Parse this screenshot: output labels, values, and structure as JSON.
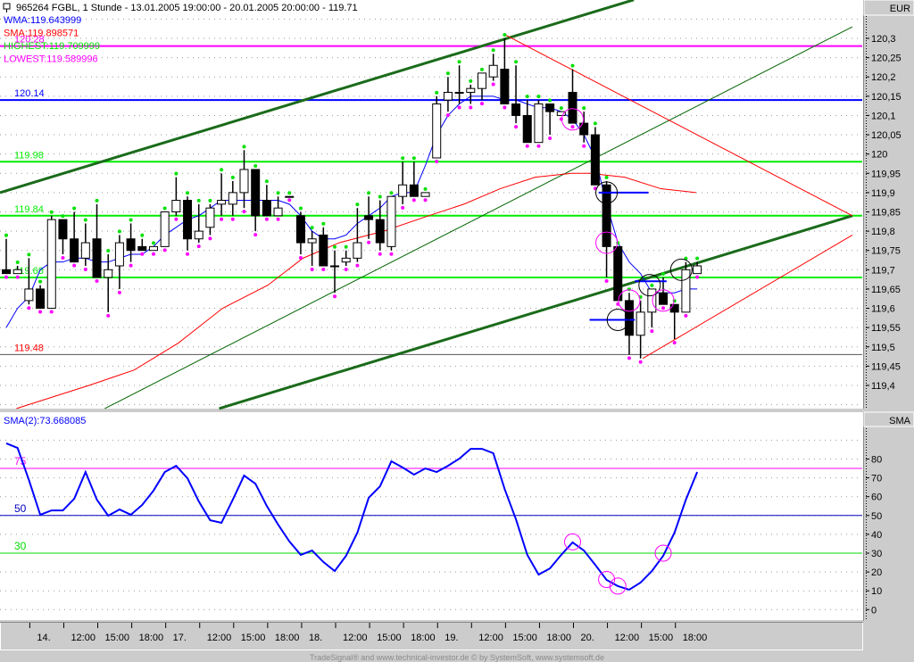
{
  "header": {
    "title": "965264  FGBL, 1 Stunde - 13.01.2005 19:00:00 - 20.01.2005 20:00:00 - 119.71",
    "currency": "EUR",
    "lower_axis_title": "SMA",
    "footer": "TradeSignal® and www.technical-investor.de © by SystemSoft, www.systemsoft.de"
  },
  "legend": [
    {
      "text": "WMA:119.643999",
      "color": "#0000ff"
    },
    {
      "text": "SMA:119.898571",
      "color": "#ff0000"
    },
    {
      "text": "HIGHEST:119.709999",
      "color": "#00e000"
    },
    {
      "text": "LOWEST:119.589996",
      "color": "#ff00ff"
    }
  ],
  "colors": {
    "wma": "#0000ff",
    "sma": "#ff0000",
    "channel": "#006400",
    "green_dot": "#00e000",
    "pink_dot": "#ff00ff",
    "oscillator": "#0000ff"
  },
  "chart_data": [
    {
      "type": "candlestick",
      "title": "965264 FGBL, 1 Stunde",
      "ylabel": "EUR",
      "ylim": [
        119.35,
        120.36
      ],
      "yticks": [
        "120,3",
        "120,25",
        "120,2",
        "120,15",
        "120,1",
        "120,05",
        "120",
        "119,95",
        "119,9",
        "119,85",
        "119,8",
        "119,75",
        "119,7",
        "119,65",
        "119,6",
        "119,55",
        "119,5",
        "119,45",
        "119,4"
      ],
      "ytick_values": [
        120.3,
        120.25,
        120.2,
        120.15,
        120.1,
        120.05,
        120.0,
        119.95,
        119.9,
        119.85,
        119.8,
        119.75,
        119.7,
        119.65,
        119.6,
        119.55,
        119.5,
        119.45,
        119.4
      ],
      "xticks": [
        "14.",
        "12:00",
        "15:00",
        "18:00",
        "17.",
        "12:00",
        "15:00",
        "18:00",
        "18.",
        "12:00",
        "15:00",
        "18:00",
        "19.",
        "12:00",
        "15:00",
        "18:00",
        "20.",
        "12:00",
        "15:00",
        "18:00"
      ],
      "xtick_bar_index": [
        2,
        5,
        8,
        11,
        14,
        17,
        20,
        23,
        26,
        29,
        32,
        35,
        38,
        41,
        44,
        47,
        50,
        53,
        56,
        59
      ],
      "grid": true,
      "ohlc": [
        [
          119.7,
          119.78,
          119.69,
          119.69
        ],
        [
          119.69,
          119.71,
          119.69,
          119.7
        ],
        [
          119.62,
          119.73,
          119.61,
          119.65
        ],
        [
          119.65,
          119.66,
          119.6,
          119.6
        ],
        [
          119.6,
          119.84,
          119.6,
          119.83
        ],
        [
          119.83,
          119.83,
          119.74,
          119.78
        ],
        [
          119.78,
          119.85,
          119.72,
          119.72
        ],
        [
          119.73,
          119.82,
          119.71,
          119.77
        ],
        [
          119.78,
          119.87,
          119.68,
          119.68
        ],
        [
          119.68,
          119.74,
          119.59,
          119.7
        ],
        [
          119.71,
          119.79,
          119.65,
          119.77
        ],
        [
          119.78,
          119.82,
          119.72,
          119.75
        ],
        [
          119.76,
          119.78,
          119.75,
          119.75
        ],
        [
          119.75,
          119.76,
          119.75,
          119.76
        ],
        [
          119.76,
          119.85,
          119.76,
          119.85
        ],
        [
          119.85,
          119.94,
          119.84,
          119.88
        ],
        [
          119.88,
          119.89,
          119.75,
          119.78
        ],
        [
          119.78,
          119.87,
          119.77,
          119.8
        ],
        [
          119.81,
          119.87,
          119.79,
          119.86
        ],
        [
          119.87,
          119.95,
          119.84,
          119.88
        ],
        [
          119.87,
          119.93,
          119.84,
          119.9
        ],
        [
          119.9,
          120.01,
          119.86,
          119.96
        ],
        [
          119.96,
          119.96,
          119.8,
          119.84
        ],
        [
          119.88,
          119.92,
          119.84,
          119.84
        ],
        [
          119.84,
          119.89,
          119.84,
          119.86
        ],
        [
          119.89,
          119.89,
          119.89,
          119.89
        ],
        [
          119.84,
          119.85,
          119.74,
          119.77
        ],
        [
          119.77,
          119.8,
          119.71,
          119.78
        ],
        [
          119.79,
          119.81,
          119.71,
          119.71
        ],
        [
          119.71,
          119.75,
          119.64,
          119.71
        ],
        [
          119.72,
          119.75,
          119.71,
          119.73
        ],
        [
          119.73,
          119.86,
          119.72,
          119.77
        ],
        [
          119.84,
          119.89,
          119.78,
          119.83
        ],
        [
          119.83,
          119.88,
          119.75,
          119.77
        ],
        [
          119.76,
          119.89,
          119.75,
          119.89
        ],
        [
          119.89,
          119.98,
          119.87,
          119.92
        ],
        [
          119.92,
          119.98,
          119.89,
          119.89
        ],
        [
          119.89,
          119.9,
          119.89,
          119.9
        ],
        [
          119.99,
          120.15,
          119.99,
          120.13
        ],
        [
          120.14,
          120.2,
          120.11,
          120.16
        ],
        [
          120.16,
          120.23,
          120.13,
          120.16
        ],
        [
          120.16,
          120.18,
          120.13,
          120.17
        ],
        [
          120.17,
          120.21,
          120.14,
          120.21
        ],
        [
          120.2,
          120.26,
          120.19,
          120.23
        ],
        [
          120.22,
          120.3,
          120.13,
          120.13
        ],
        [
          120.13,
          120.23,
          120.08,
          120.1
        ],
        [
          120.1,
          120.14,
          120.03,
          120.03
        ],
        [
          120.03,
          120.14,
          120.03,
          120.13
        ],
        [
          120.13,
          120.13,
          120.05,
          120.11
        ],
        [
          120.1,
          120.11,
          120.1,
          120.11
        ],
        [
          120.16,
          120.22,
          120.08,
          120.08
        ],
        [
          120.08,
          120.11,
          120.03,
          120.05
        ],
        [
          120.05,
          120.07,
          119.92,
          119.92
        ],
        [
          119.92,
          119.93,
          119.68,
          119.76
        ],
        [
          119.76,
          119.76,
          119.62,
          119.62
        ],
        [
          119.62,
          119.64,
          119.48,
          119.53
        ],
        [
          119.53,
          119.62,
          119.47,
          119.59
        ],
        [
          119.59,
          119.65,
          119.55,
          119.65
        ],
        [
          119.64,
          119.68,
          119.61,
          119.61
        ],
        [
          119.61,
          119.61,
          119.52,
          119.59
        ],
        [
          119.59,
          119.72,
          119.59,
          119.7
        ],
        [
          119.69,
          119.72,
          119.69,
          119.71
        ]
      ],
      "wma": [
        119.55,
        119.6,
        119.63,
        119.7,
        119.72,
        119.72,
        119.73,
        119.73,
        119.72,
        119.72,
        119.73,
        119.74,
        119.74,
        119.76,
        119.79,
        119.81,
        119.83,
        119.84,
        119.86,
        119.88,
        119.88,
        119.88,
        119.88,
        119.88,
        119.88,
        119.87,
        119.84,
        119.8,
        119.78,
        119.78,
        119.79,
        119.82,
        119.84,
        119.86,
        119.89,
        119.9,
        119.9,
        119.97,
        120.05,
        120.1,
        120.13,
        120.15,
        120.15,
        120.15,
        120.14,
        120.14,
        120.13,
        120.12,
        120.12,
        120.11,
        120.09,
        120.05,
        119.99,
        119.87,
        119.77,
        119.72,
        119.69,
        119.64,
        119.64,
        119.64,
        119.65,
        119.65
      ],
      "sma_points": [
        [
          0.9,
          119.34
        ],
        [
          7.3,
          119.4
        ],
        [
          11.3,
          119.44
        ],
        [
          15.2,
          119.51
        ],
        [
          19.1,
          119.6
        ],
        [
          23.1,
          119.66
        ],
        [
          26.2,
          119.73
        ],
        [
          29.4,
          119.77
        ],
        [
          33.3,
          119.8
        ],
        [
          37.3,
          119.84
        ],
        [
          40.4,
          119.87
        ],
        [
          43.6,
          119.91
        ],
        [
          46.7,
          119.94
        ],
        [
          49.9,
          119.95
        ],
        [
          51.5,
          119.95
        ],
        [
          54.6,
          119.94
        ],
        [
          57.8,
          119.91
        ],
        [
          60.9,
          119.9
        ]
      ],
      "horizontal_levels": [
        {
          "label": "120.28",
          "value": 120.28,
          "color": "#ff00ff"
        },
        {
          "label": "120.14",
          "value": 120.14,
          "color": "#0000ff"
        },
        {
          "label": "119.98",
          "value": 119.98,
          "color": "#00ee00"
        },
        {
          "label": "119.84",
          "value": 119.84,
          "color": "#00ee00"
        },
        {
          "label": "119.68",
          "value": 119.68,
          "color": "#00ee00"
        },
        {
          "label": "119.48",
          "value": 119.48,
          "color": "#ff0000",
          "line_color": "#555555"
        }
      ],
      "trend_lines": [
        {
          "from": [
            -0.55,
            119.9
          ],
          "to": [
            55.4,
            120.4
          ],
          "color": "#1a6b1a",
          "weight": "thick"
        },
        {
          "from": [
            18.8,
            119.34
          ],
          "to": [
            74.7,
            119.84
          ],
          "color": "#1a6b1a",
          "weight": "thick"
        },
        {
          "from": [
            8.7,
            119.34
          ],
          "to": [
            74.7,
            120.33
          ],
          "color": "#006400",
          "weight": "thin"
        },
        {
          "from": [
            44.0,
            120.31
          ],
          "to": [
            74.7,
            119.84
          ],
          "color": "#ff0000",
          "weight": "thin"
        },
        {
          "from": [
            56.2,
            119.47
          ],
          "to": [
            74.7,
            119.79
          ],
          "color": "#ff0000",
          "weight": "thin"
        }
      ],
      "blue_segments": [
        [
          52.3,
          56.7,
          119.9
        ],
        [
          51.5,
          55.5,
          119.57
        ],
        [
          55.5,
          58.3,
          119.67
        ]
      ],
      "black_circles": [
        [
          53,
          119.9
        ],
        [
          54,
          119.57
        ],
        [
          56.8,
          119.66
        ],
        [
          59.6,
          119.7
        ]
      ],
      "magenta_circles": [
        [
          50,
          120.09
        ],
        [
          53,
          119.77
        ],
        [
          55,
          119.62
        ],
        [
          58,
          119.62
        ]
      ]
    },
    {
      "type": "line",
      "title": "SMA(2):73.668085",
      "ylabel": "SMA",
      "ylim": [
        -4,
        95
      ],
      "yticks": [
        "80",
        "70",
        "60",
        "50",
        "40",
        "30",
        "20",
        "10",
        "0"
      ],
      "ytick_values": [
        80,
        70,
        60,
        50,
        40,
        30,
        20,
        10,
        0
      ],
      "levels": [
        {
          "label": "75",
          "value": 75,
          "color": "#ff00ff"
        },
        {
          "label": "50",
          "value": 50,
          "color": "#0000c0"
        },
        {
          "label": "30",
          "value": 30,
          "color": "#00dd00"
        }
      ],
      "values": [
        88.3,
        85.9,
        68.9,
        50.4,
        52.7,
        52.7,
        58.9,
        73.1,
        58.4,
        49.9,
        53.2,
        50.4,
        55.6,
        63.2,
        73.1,
        76.4,
        69.8,
        57.5,
        47.5,
        46.1,
        58.4,
        71.2,
        66.9,
        55.1,
        45.2,
        36.2,
        29.1,
        31.4,
        25.3,
        20.5,
        28.6,
        40.9,
        59.4,
        65.5,
        78.8,
        75.5,
        71.7,
        75.0,
        73.1,
        76.4,
        80.2,
        85.4,
        85.4,
        83.1,
        64.1,
        48.0,
        29.1,
        18.6,
        21.9,
        29.1,
        35.7,
        31.4,
        23.8,
        15.8,
        12.5,
        10.6,
        14.4,
        20.5,
        28.6,
        40.9,
        58.4,
        73.1
      ],
      "magenta_circles": [
        [
          50,
          36
        ],
        [
          53,
          16
        ],
        [
          54,
          12.5
        ],
        [
          58,
          30
        ]
      ]
    }
  ]
}
